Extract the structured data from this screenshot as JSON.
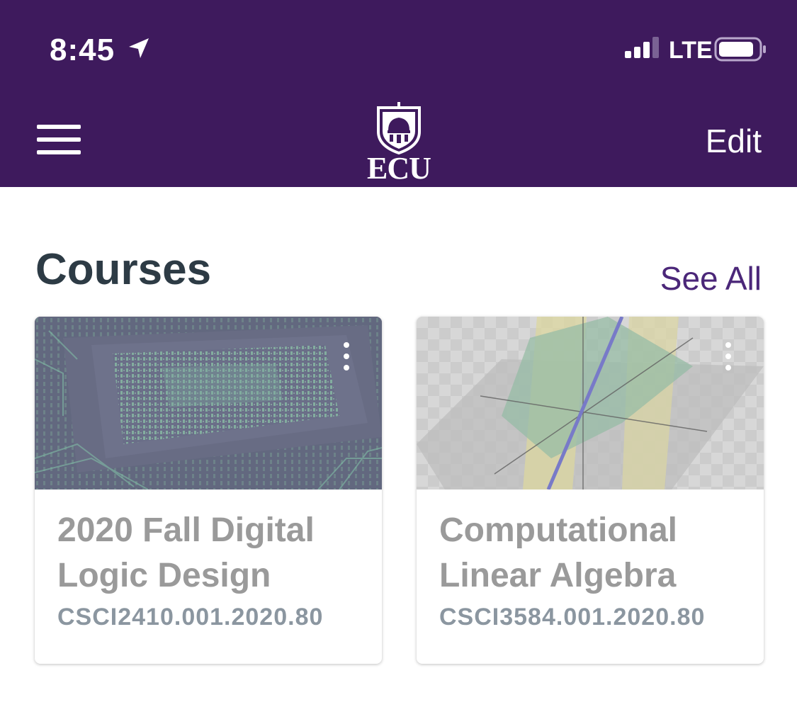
{
  "status_bar": {
    "time": "8:45",
    "network": "LTE",
    "location_icon": "location-arrow-icon",
    "signal_icon": "signal-bars-icon",
    "battery_icon": "battery-icon"
  },
  "nav": {
    "menu_icon": "hamburger-menu-icon",
    "logo_text": "ECU",
    "edit_label": "Edit"
  },
  "courses": {
    "title": "Courses",
    "see_all_label": "See All",
    "items": [
      {
        "name_line1": "2020 Fall Digital",
        "name_line2": "Logic Design",
        "code": "CSCI2410.001.2020.80",
        "image": "circuit-board-chip-image",
        "overlay_color": "#3e1a5d"
      },
      {
        "name_line1": "Computational",
        "name_line2": "Linear Algebra",
        "code": "CSCI3584.001.2020.80",
        "image": "3d-planes-graph-image",
        "overlay_color": "#9a9a9a"
      }
    ]
  },
  "colors": {
    "header_bg": "#3e1a5d",
    "accent": "#4b2779",
    "title_text": "#2d3b45",
    "muted_text": "#9a9a9a"
  }
}
